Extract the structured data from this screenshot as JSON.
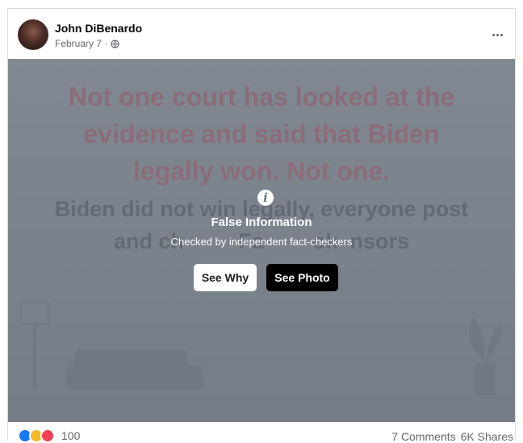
{
  "post": {
    "author": "John DiBenardo",
    "date": "February 7 ·",
    "privacy_icon": "globe-icon"
  },
  "photo": {
    "headline_lines": [
      "Not one court has looked at the",
      "evidence and said that Biden",
      "legally won.  Not one."
    ],
    "subtext_lines": [
      "Biden did not win legally, everyone post",
      "and ch         Fa        ok  nsors"
    ]
  },
  "warning": {
    "icon": "info-icon",
    "title": "False Information",
    "subtitle": "Checked by independent fact-checkers",
    "see_why_label": "See Why",
    "see_photo_label": "See Photo"
  },
  "footer": {
    "reaction_count": "100",
    "comments": "7 Comments",
    "shares": "6K Shares"
  },
  "colors": {
    "like": "#1877f2",
    "haha": "#f7b928",
    "love": "#f33e58"
  }
}
